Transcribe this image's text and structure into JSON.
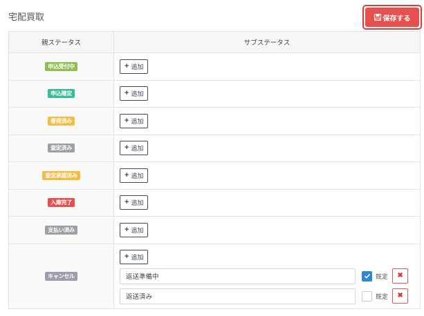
{
  "page": {
    "title": "宅配買取",
    "save_label": "保存する",
    "save_icon": "floppy-disk-icon"
  },
  "table": {
    "headers": {
      "parent": "親ステータス",
      "sub": "サブステータス"
    },
    "add_label": "追加",
    "rows": [
      {
        "badge": "申込受付中",
        "color": "#8cc152"
      },
      {
        "badge": "申込確定",
        "color": "#37bc9b"
      },
      {
        "badge": "着荷済み",
        "color": "#f6bb42"
      },
      {
        "badge": "査定済み",
        "color": "#9aa0a6"
      },
      {
        "badge": "査定承認済み",
        "color": "#f6bb42"
      },
      {
        "badge": "入庫完了",
        "color": "#e84f4f"
      },
      {
        "badge": "支払い済み",
        "color": "#9aa0a6"
      },
      {
        "badge": "キャンセル",
        "color": "#9aa0a6"
      }
    ],
    "cancel_substatuses": [
      {
        "value": "返送準備中",
        "default_checked": true,
        "default_label": "既定"
      },
      {
        "value": "返送済み",
        "default_checked": false,
        "default_label": "既定"
      }
    ]
  }
}
